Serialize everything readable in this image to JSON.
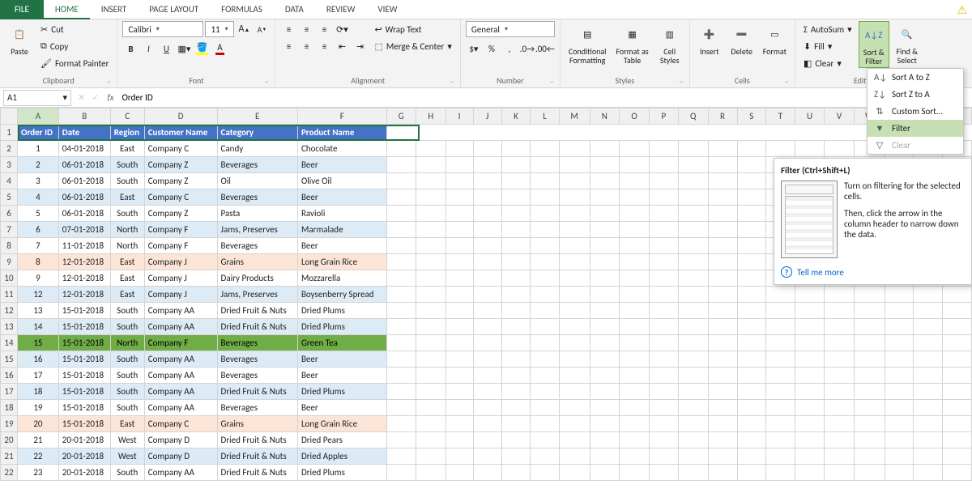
{
  "tabs": {
    "file": "FILE",
    "home": "HOME",
    "insert": "INSERT",
    "page_layout": "PAGE LAYOUT",
    "formulas": "FORMULAS",
    "data": "DATA",
    "review": "REVIEW",
    "view": "VIEW"
  },
  "ribbon": {
    "clipboard": {
      "paste": "Paste",
      "cut": "Cut",
      "copy": "Copy",
      "format_painter": "Format Painter",
      "label": "Clipboard"
    },
    "font": {
      "name": "Calibri",
      "size": "11",
      "bold": "B",
      "italic": "I",
      "underline": "U",
      "label": "Font"
    },
    "alignment": {
      "wrap": "Wrap Text",
      "merge": "Merge & Center",
      "label": "Alignment"
    },
    "number": {
      "format": "General",
      "label": "Number"
    },
    "styles": {
      "cond": "Conditional\nFormatting",
      "table": "Format as\nTable",
      "cell": "Cell\nStyles",
      "label": "Styles"
    },
    "cells": {
      "insert": "Insert",
      "delete": "Delete",
      "format": "Format",
      "label": "Cells"
    },
    "editing": {
      "autosum": "AutoSum",
      "fill": "Fill",
      "clear": "Clear",
      "sort": "Sort &\nFilter",
      "find": "Find &\nSelect",
      "label": "Editi"
    }
  },
  "sort_menu": {
    "az": "Sort A to Z",
    "za": "Sort Z to A",
    "custom": "Custom Sort...",
    "filter": "Filter",
    "clear": "Clear"
  },
  "tooltip": {
    "title": "Filter (Ctrl+Shift+L)",
    "p1": "Turn on filtering for the selected cells.",
    "p2": "Then, click the arrow in the column header to narrow down the data.",
    "more": "Tell me more"
  },
  "fbar": {
    "cell": "A1",
    "value": "Order ID"
  },
  "columns": [
    "A",
    "B",
    "C",
    "D",
    "E",
    "F",
    "G",
    "H",
    "I",
    "J",
    "K",
    "L",
    "M",
    "N",
    "O",
    "P"
  ],
  "rest_cols": [
    "G",
    "H",
    "I",
    "J",
    "K",
    "L",
    "M",
    "N",
    "O",
    "P",
    "Q",
    "R",
    "S",
    "T"
  ],
  "col_letters_after_F": [
    "G",
    "H",
    "I",
    "J",
    "K",
    "L",
    "M",
    "N",
    "O",
    "P",
    "Q",
    "R",
    "S"
  ],
  "letters_lookup": {
    "G": "G",
    "H": "H",
    "I": "I",
    "J": "J",
    "K": "K",
    "L": "L",
    "M": "M",
    "N": "N",
    "O": "O",
    "P": "P",
    "Q": "Q",
    "R": "R",
    "S": "S"
  },
  "header": {
    "a": "Order ID",
    "b": "Date",
    "c": "Region",
    "d": "Customer Name",
    "e": "Category",
    "f": "Product Name"
  },
  "rows": [
    {
      "n": "1",
      "id": "1",
      "date": "04-01-2018",
      "region": "East",
      "cust": "Company C",
      "cat": "Candy",
      "prod": "Chocolate",
      "cls": ""
    },
    {
      "n": "2",
      "id": "2",
      "date": "06-01-2018",
      "region": "South",
      "cust": "Company Z",
      "cat": "Beverages",
      "prod": "Beer",
      "cls": "band"
    },
    {
      "n": "3",
      "id": "3",
      "date": "06-01-2018",
      "region": "South",
      "cust": "Company Z",
      "cat": "Oil",
      "prod": "Olive Oil",
      "cls": ""
    },
    {
      "n": "4",
      "id": "4",
      "date": "06-01-2018",
      "region": "East",
      "cust": "Company C",
      "cat": "Beverages",
      "prod": "Beer",
      "cls": "band"
    },
    {
      "n": "5",
      "id": "5",
      "date": "06-01-2018",
      "region": "South",
      "cust": "Company Z",
      "cat": "Pasta",
      "prod": "Ravioli",
      "cls": ""
    },
    {
      "n": "6",
      "id": "6",
      "date": "07-01-2018",
      "region": "North",
      "cust": "Company F",
      "cat": "Jams, Preserves",
      "prod": "Marmalade",
      "cls": "band"
    },
    {
      "n": "7",
      "id": "7",
      "date": "11-01-2018",
      "region": "North",
      "cust": "Company F",
      "cat": "Beverages",
      "prod": "Beer",
      "cls": ""
    },
    {
      "n": "8",
      "id": "8",
      "date": "12-01-2018",
      "region": "East",
      "cust": "Company J",
      "cat": "Grains",
      "prod": "Long Grain Rice",
      "cls": "orange"
    },
    {
      "n": "9",
      "id": "9",
      "date": "12-01-2018",
      "region": "East",
      "cust": "Company J",
      "cat": "Dairy Products",
      "prod": "Mozzarella",
      "cls": ""
    },
    {
      "n": "10",
      "id": "12",
      "date": "12-01-2018",
      "region": "East",
      "cust": "Company J",
      "cat": "Jams, Preserves",
      "prod": "Boysenberry Spread",
      "cls": "band"
    },
    {
      "n": "11",
      "id": "13",
      "date": "15-01-2018",
      "region": "South",
      "cust": "Company AA",
      "cat": "Dried Fruit & Nuts",
      "prod": "Dried Plums",
      "cls": ""
    },
    {
      "n": "12",
      "id": "14",
      "date": "15-01-2018",
      "region": "South",
      "cust": "Company AA",
      "cat": "Dried Fruit & Nuts",
      "prod": "Dried Plums",
      "cls": "band"
    },
    {
      "n": "13",
      "id": "15",
      "date": "15-01-2018",
      "region": "North",
      "cust": "Company F",
      "cat": "Beverages",
      "prod": "Green Tea",
      "cls": "green"
    },
    {
      "n": "14",
      "id": "16",
      "date": "15-01-2018",
      "region": "South",
      "cust": "Company AA",
      "cat": "Beverages",
      "prod": "Beer",
      "cls": "band"
    },
    {
      "n": "15",
      "id": "17",
      "date": "15-01-2018",
      "region": "South",
      "cust": "Company AA",
      "cat": "Beverages",
      "prod": "Beer",
      "cls": ""
    },
    {
      "n": "16",
      "id": "18",
      "date": "15-01-2018",
      "region": "South",
      "cust": "Company AA",
      "cat": "Dried Fruit & Nuts",
      "prod": "Dried Plums",
      "cls": "band"
    },
    {
      "n": "17",
      "id": "19",
      "date": "15-01-2018",
      "region": "South",
      "cust": "Company AA",
      "cat": "Beverages",
      "prod": "Beer",
      "cls": ""
    },
    {
      "n": "18",
      "id": "20",
      "date": "15-01-2018",
      "region": "East",
      "cust": "Company C",
      "cat": "Grains",
      "prod": "Long Grain Rice",
      "cls": "orange"
    },
    {
      "n": "19",
      "id": "21",
      "date": "20-01-2018",
      "region": "West",
      "cust": "Company D",
      "cat": "Dried Fruit & Nuts",
      "prod": "Dried Pears",
      "cls": ""
    },
    {
      "n": "20",
      "id": "22",
      "date": "20-01-2018",
      "region": "West",
      "cust": "Company D",
      "cat": "Dried Fruit & Nuts",
      "prod": "Dried Apples",
      "cls": "band"
    },
    {
      "n": "21",
      "id": "23",
      "date": "20-01-2018",
      "region": "South",
      "cust": "Company AA",
      "cat": "Dried Fruit & Nuts",
      "prod": "Dried Plums",
      "cls": ""
    }
  ]
}
